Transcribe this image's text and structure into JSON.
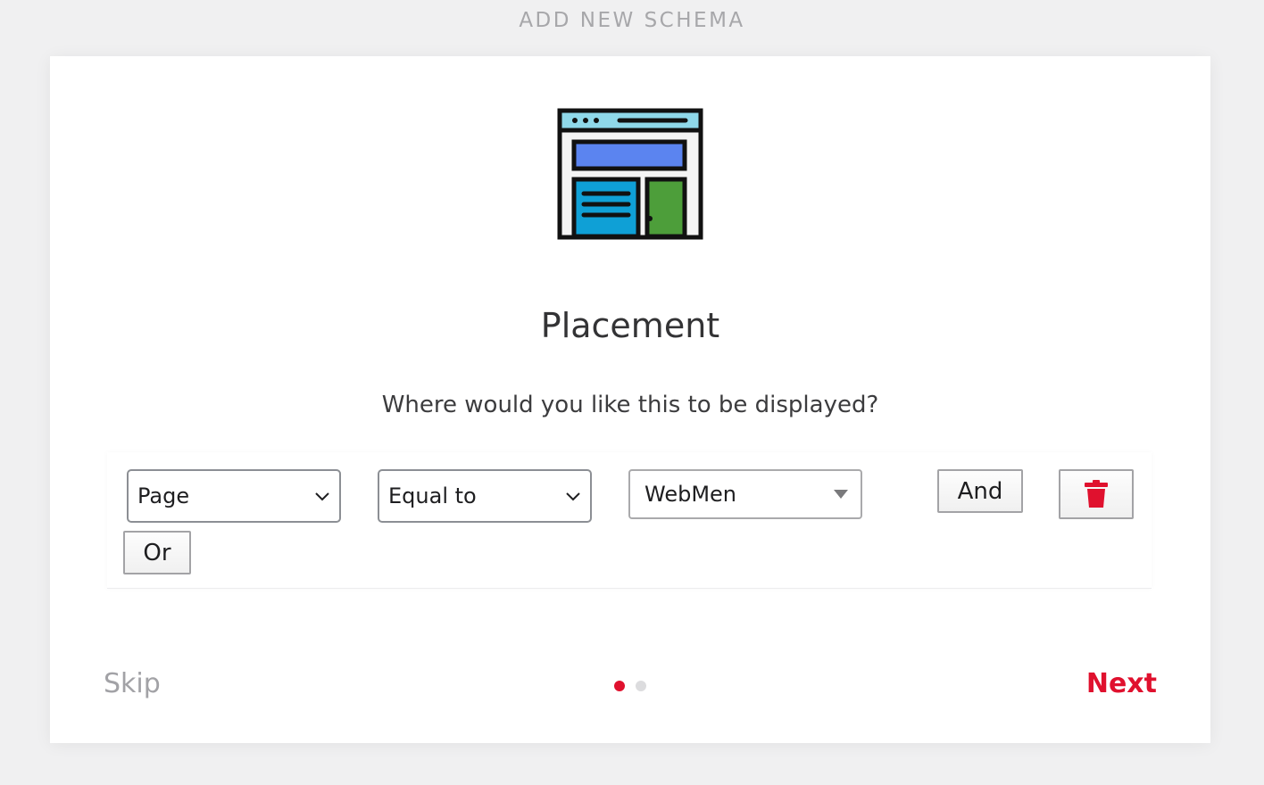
{
  "header": {
    "title": "ADD NEW SCHEMA"
  },
  "step": {
    "icon": "webpage-layout-icon",
    "title": "Placement",
    "question": "Where would you like this to be displayed?"
  },
  "rule": {
    "field_select": {
      "value": "Page"
    },
    "operator_select": {
      "value": "Equal to"
    },
    "value_select": {
      "value": "WebMen"
    },
    "and_label": "And",
    "delete_icon": "trash-icon",
    "or_label": "Or"
  },
  "footer": {
    "skip_label": "Skip",
    "next_label": "Next",
    "pagination": {
      "current": 1,
      "total": 2
    }
  },
  "colors": {
    "accent": "#e0112e",
    "dot_inactive": "#dcdcde",
    "muted_text": "#a2a2a6"
  }
}
